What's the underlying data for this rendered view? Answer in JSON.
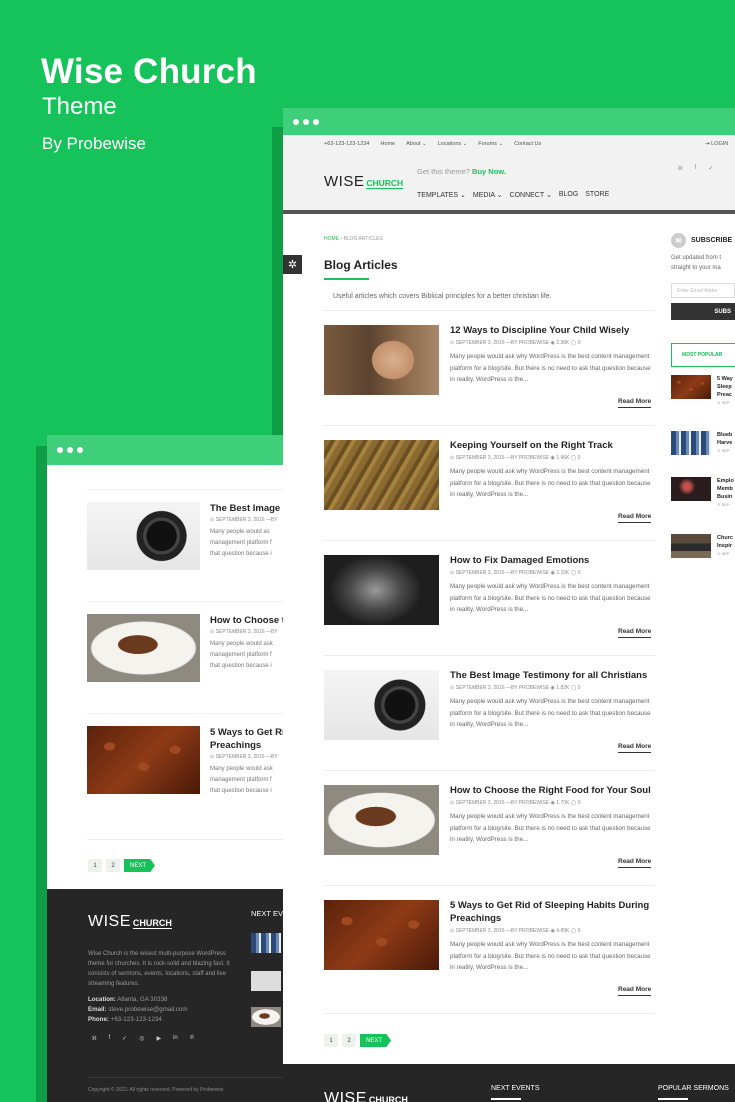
{
  "hero": {
    "title": "Wise Church",
    "subtitle": "Theme",
    "byline": "By Probewise"
  },
  "colors": {
    "brand": "#16c25a",
    "background": "#16c25a",
    "footer": "#262626"
  },
  "logo": {
    "wise": "WISE",
    "church": "CHURCH"
  },
  "topbar": {
    "phone": "+63-123-123-1234",
    "links": [
      "Home",
      "About ⌄",
      "Locations ⌄",
      "Forums ⌄",
      "Contact Us"
    ],
    "login": "⇥ LOGIN"
  },
  "header": {
    "promo_text": "Get this theme?",
    "promo_link": "Buy Now.",
    "nav": [
      "TEMPLATES ⌄",
      "MEDIA ⌄",
      "CONNECT ⌄",
      "BLOG",
      "STORE"
    ],
    "social_icons": [
      "rss-icon",
      "facebook-icon",
      "twitter-icon"
    ]
  },
  "breadcrumb": {
    "home": "HOME",
    "current": "› BLOG ARTICLES"
  },
  "page": {
    "title": "Blog Articles",
    "description": "Useful articles which covers Biblical principles for a better christian life."
  },
  "posts": [
    {
      "title": "12 Ways to Discipline Your Child Wisely",
      "meta": "⊙ SEPTEMBER 3, 2016 —BY PROBEWISE  ◉ 2.30K  ◯ 0",
      "excerpt": "Many people would ask why WordPress is the best content management platform for a blog/site. But there is no need to ask that question because in reality, WordPress is the...",
      "read_more": "Read More",
      "thumb": "girl"
    },
    {
      "title": "Keeping Yourself on the Right Track",
      "meta": "⊙ SEPTEMBER 3, 2016 —BY PROBEWISE  ◉ 1.96K  ◯ 0",
      "excerpt": "Many people would ask why WordPress is the best content management platform for a blog/site. But there is no need to ask that question because in reality, WordPress is the...",
      "read_more": "Read More",
      "thumb": "tracks"
    },
    {
      "title": "How to Fix Damaged Emotions",
      "meta": "⊙ SEPTEMBER 3, 2016 —BY PROBEWISE  ◉ 2.15K  ◯ 0",
      "excerpt": "Many people would ask why WordPress is the best content management platform for a blog/site. But there is no need to ask that question because in reality, WordPress is the...",
      "read_more": "Read More",
      "thumb": "bw"
    },
    {
      "title": "The Best Image Testimony for all Christians",
      "meta": "⊙ SEPTEMBER 3, 2016 —BY PROBEWISE  ◉ 1.82K  ◯ 0",
      "excerpt": "Many people would ask why WordPress is the best content management platform for a blog/site. But there is no need to ask that question because in reality, WordPress is the...",
      "read_more": "Read More",
      "thumb": "camera"
    },
    {
      "title": "How to Choose the Right Food for Your Soul",
      "meta": "⊙ SEPTEMBER 3, 2016 —BY PROBEWISE  ◉ 1.70K  ◯ 0",
      "excerpt": "Many people would ask why WordPress is the best content management platform for a blog/site. But there is no need to ask that question because in reality, WordPress is the...",
      "read_more": "Read More",
      "thumb": "food"
    },
    {
      "title": "5 Ways to Get Rid of Sleeping Habits During Preachings",
      "meta": "⊙ SEPTEMBER 3, 2016 —BY PROBEWISE  ◉ 4.89K  ◯ 5",
      "excerpt": "Many people would ask why WordPress is the best content management platform for a blog/site. But there is no need to ask that question because in reality, WordPress is the...",
      "read_more": "Read More",
      "thumb": "coffee"
    }
  ],
  "pagination": {
    "pages": [
      "1",
      "2"
    ],
    "next": "NEXT"
  },
  "sidebar": {
    "subscribe_title": "SUBSCRIBE",
    "subscribe_text_1": "Get updated from t",
    "subscribe_text_2": "straight to your ma",
    "email_placeholder": "Enter Email Addre",
    "subscribe_button": "SUBS",
    "popular_tab": "MOST POPULAR",
    "popular": [
      {
        "lines": [
          "5 Way",
          "Sleep",
          "Preac"
        ],
        "meta": "⊙ SEP",
        "thumb": "coffee"
      },
      {
        "lines": [
          "Blueb",
          "Harve"
        ],
        "meta": "⊙ SEP",
        "thumb": "cards"
      },
      {
        "lines": [
          "Emplo",
          "Memb",
          "Busin"
        ],
        "meta": "⊙ SEP",
        "thumb": "dark"
      },
      {
        "lines": [
          "Churc",
          "Inspir"
        ],
        "meta": "⊙ SEP",
        "thumb": "laptop"
      }
    ]
  },
  "back_window": {
    "posts": [
      {
        "title_lines": [
          "The Best Image T"
        ],
        "meta": "⊙ SEPTEMBER 3, 2016 —BY",
        "excerpt": [
          "Many people would as",
          "management platform f",
          "that question because i"
        ],
        "thumb": "camera"
      },
      {
        "title_lines": [
          "How to Choose t"
        ],
        "meta": "⊙ SEPTEMBER 3, 2016 —BY",
        "excerpt": [
          "Many people would ask",
          "management platform f",
          "that question because i"
        ],
        "thumb": "food"
      },
      {
        "title_lines": [
          "5 Ways to Get Ri",
          "Preachings"
        ],
        "meta": "⊙ SEPTEMBER 3, 2016 —BY",
        "excerpt": [
          "Many people would ask",
          "management platform f",
          "that question because i"
        ],
        "thumb": "coffee"
      }
    ]
  },
  "footer": {
    "description": "Wise Church is the wisest multi-purpose WordPress theme for churches. It is rock-solid and blazing fast. It consists of sermons, events, locations, staff and live streaming features.",
    "location_label": "Location:",
    "location": "Atlanta, GA 30338",
    "email_label": "Email:",
    "email": "steve.probewise@gmail.com",
    "phone_label": "Phone:",
    "phone": "+63-123-123-1234",
    "social": [
      "rss-icon",
      "facebook-icon",
      "twitter-icon",
      "instagram-icon",
      "youtube-icon",
      "linkedin-icon",
      "pinterest-icon"
    ],
    "next_events_short": "NEXT EV",
    "next_events": "NEXT EVENTS",
    "popular_sermons": "POPULAR SERMONS",
    "copyright": "Copyright © 2022. All rights reserved. Powered by Probewise."
  }
}
